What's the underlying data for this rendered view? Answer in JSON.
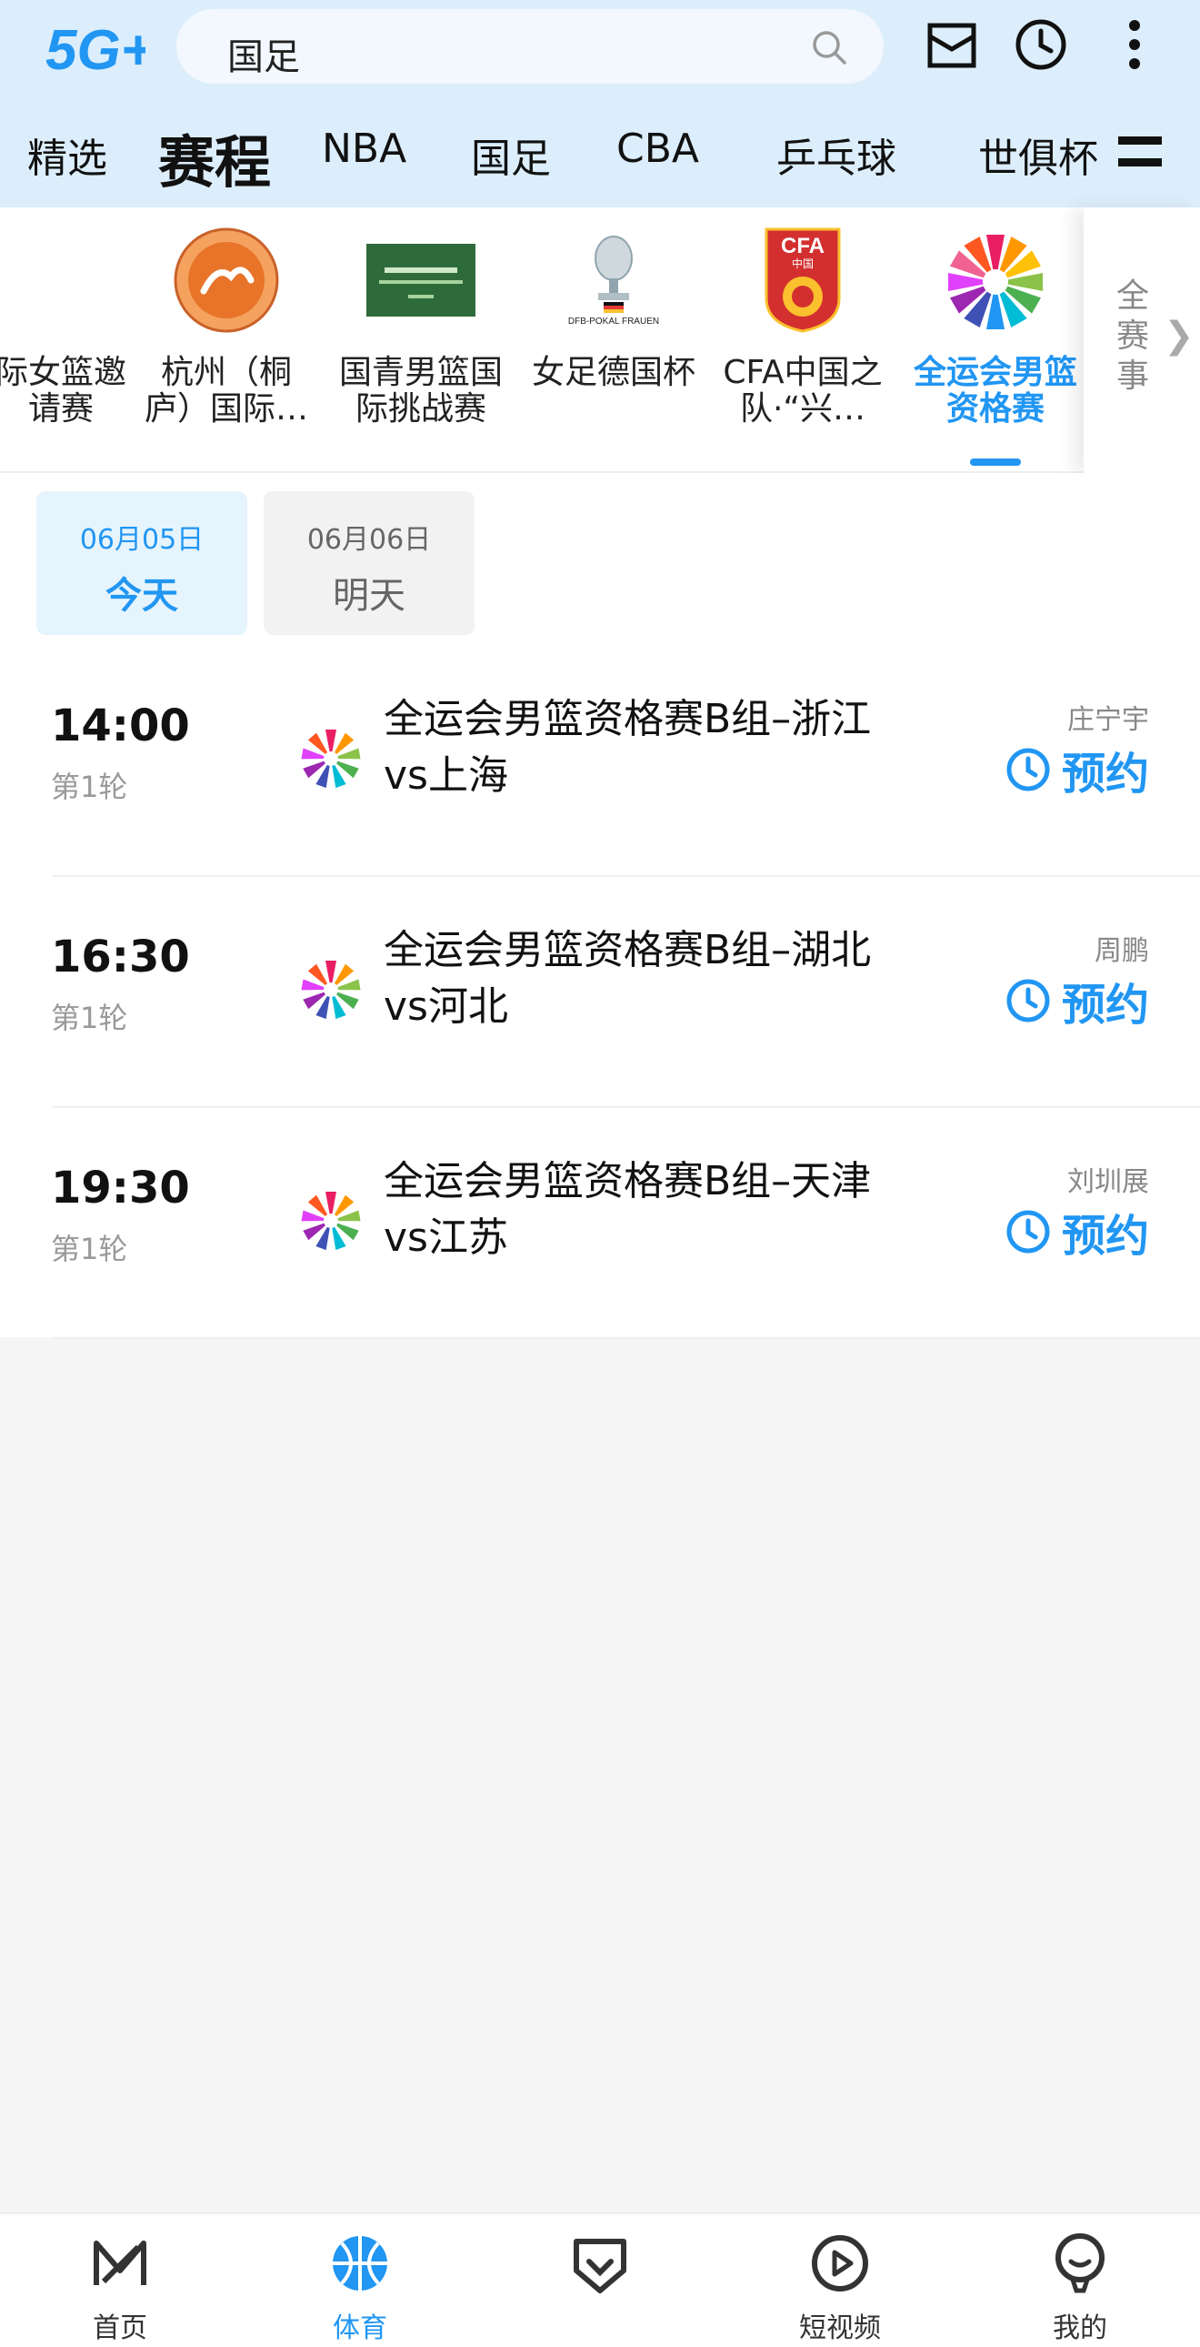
{
  "header": {
    "logo_text": "5G++",
    "search_text": "国足"
  },
  "nav": {
    "items": [
      {
        "label": "精选"
      },
      {
        "label": "赛程"
      },
      {
        "label": "NBA"
      },
      {
        "label": "国足"
      },
      {
        "label": "CBA"
      },
      {
        "label": "乒乓球"
      },
      {
        "label": "世俱杯"
      }
    ],
    "active": "赛程"
  },
  "competitions": {
    "items": [
      {
        "name": "际女篮邀\n请赛",
        "icon": "basketball-invitational-logo"
      },
      {
        "name": "杭州（桐\n庐）国际…",
        "icon": "china-basketball-association-logo"
      },
      {
        "name": "国青男篮国\n际挑战赛",
        "icon": "youth-basketball-challenge-banner"
      },
      {
        "name": "女足德国杯",
        "icon": "dfb-pokal-frauen-trophy"
      },
      {
        "name": "CFA中国之\n队·“兴…",
        "icon": "cfa-china-badge"
      },
      {
        "name": "全运会男篮\n资格赛",
        "icon": "national-games-flower-logo"
      }
    ],
    "all_events_label": "全赛事",
    "cfa_badge_text": "CFA",
    "cfa_badge_sub": "中国",
    "dfb_text": "DFB-POKAL FRAUEN"
  },
  "dates": [
    {
      "date": "06月05日",
      "label": "今天"
    },
    {
      "date": "06月06日",
      "label": "明天"
    }
  ],
  "matches": [
    {
      "time": "14:00",
      "round": "第1轮",
      "title": "全运会男篮资格赛B组–浙江vs上海",
      "commentator": "庄宁宇",
      "action": "预约"
    },
    {
      "time": "16:30",
      "round": "第1轮",
      "title": "全运会男篮资格赛B组–湖北vs河北",
      "commentator": "周鹏",
      "action": "预约"
    },
    {
      "time": "19:30",
      "round": "第1轮",
      "title": "全运会男篮资格赛B组–天津vs江苏",
      "commentator": "刘圳展",
      "action": "预约"
    }
  ],
  "tabbar": {
    "items": [
      {
        "label": "首页",
        "icon": "home-icon"
      },
      {
        "label": "体育",
        "icon": "basketball-icon"
      },
      {
        "label": "",
        "icon": "heart-shield-icon"
      },
      {
        "label": "短视频",
        "icon": "play-icon"
      },
      {
        "label": "我的",
        "icon": "profile-icon"
      }
    ],
    "active": "体育"
  },
  "colors": {
    "accent": "#2196f3",
    "header_bg": "#dceefc",
    "page_bg": "#f5f5f5"
  }
}
